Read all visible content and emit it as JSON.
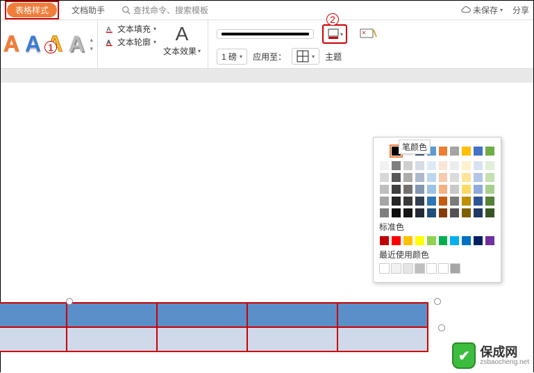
{
  "topbar": {
    "tab_active": "表格样式",
    "tab_doc_helper": "文档助手",
    "search_placeholder": "查找命令、搜索模板",
    "unsaved": "未保存",
    "share": "分享"
  },
  "ribbon": {
    "marker1": "1",
    "marker2": "2",
    "text_fill": "文本填充",
    "text_outline": "文本轮廓",
    "text_effect": "文本效果",
    "line_weight_value": "1 磅",
    "apply_to": "应用至：",
    "theme_label_partial": "主题"
  },
  "colorpop": {
    "title": "笔颜色",
    "theme_rows": [
      [
        "#ffffff",
        "#000000",
        "#e7e6e6",
        "#44546a",
        "#5b9bd5",
        "#ed7d31",
        "#a5a5a5",
        "#ffc000",
        "#4472c4",
        "#70ad47"
      ],
      [
        "#f2f2f2",
        "#7f7f7f",
        "#d0cece",
        "#d6dce4",
        "#deebf6",
        "#fbe5d5",
        "#ededed",
        "#fff2cc",
        "#d9e2f3",
        "#e2efd9"
      ],
      [
        "#d8d8d8",
        "#595959",
        "#aeabab",
        "#adb9ca",
        "#bdd7ee",
        "#f7cbac",
        "#dbdbdb",
        "#fee599",
        "#b4c6e7",
        "#c5e0b3"
      ],
      [
        "#bfbfbf",
        "#3f3f3f",
        "#757070",
        "#8496b0",
        "#9cc3e5",
        "#f4b183",
        "#c9c9c9",
        "#ffd965",
        "#8eaadb",
        "#a8d08d"
      ],
      [
        "#a5a5a5",
        "#262626",
        "#3a3838",
        "#323f4f",
        "#2e75b5",
        "#c55a11",
        "#7b7b7b",
        "#bf9000",
        "#2f5496",
        "#538135"
      ],
      [
        "#7f7f7f",
        "#0c0c0c",
        "#171616",
        "#222a35",
        "#1e4e79",
        "#833c0b",
        "#525252",
        "#7f6000",
        "#1f3864",
        "#375623"
      ]
    ],
    "standard_label": "标准色",
    "standard_row": [
      "#c00000",
      "#ff0000",
      "#ffc000",
      "#ffff00",
      "#92d050",
      "#00b050",
      "#00b0f0",
      "#0070c0",
      "#002060",
      "#7030a0"
    ],
    "recent_label": "最近使用颜色",
    "recent_row": [
      "#ffffff",
      "#f2f2f2",
      "#e6e6e6",
      "#bfbfbf",
      "#ffffff",
      "#ffffff",
      "#a5a5a5"
    ]
  },
  "watermark": {
    "text": "保成网",
    "sub": "zsbaocheng.net"
  }
}
